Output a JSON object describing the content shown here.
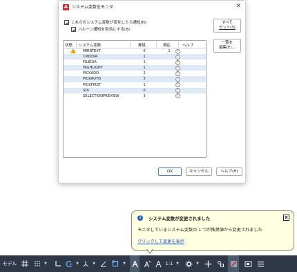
{
  "dialog": {
    "title": "システム変数をモニタ",
    "checkbox_notify": "これらのシステム変数が変化したら通知(N)",
    "checkbox_balloon": "バルーン通知を有効にする(B)",
    "columns": [
      "状態",
      "システム変数",
      "推奨",
      "現在",
      "ヘルプ"
    ],
    "rows": [
      {
        "warn": true,
        "name": "MIRRTEXT",
        "recommended": "0",
        "current": "1"
      },
      {
        "warn": false,
        "name": "CMDDIA",
        "recommended": "1",
        "current": ""
      },
      {
        "warn": false,
        "name": "FILEDIA",
        "recommended": "1",
        "current": ""
      },
      {
        "warn": false,
        "name": "HIGHLIGHT",
        "recommended": "1",
        "current": ""
      },
      {
        "warn": false,
        "name": "PICKADD",
        "recommended": "2",
        "current": ""
      },
      {
        "warn": false,
        "name": "PICKAUTO",
        "recommended": "5",
        "current": ""
      },
      {
        "warn": false,
        "name": "PICKFIRST",
        "recommended": "1",
        "current": ""
      },
      {
        "warn": false,
        "name": "SDI",
        "recommended": "0",
        "current": ""
      },
      {
        "warn": false,
        "name": "SELECTIONPREVIEW",
        "recommended": "3",
        "current": ""
      }
    ],
    "help_glyph": "?",
    "reset_all_label_1": "すべて",
    "reset_all_label_2": "セット(S)",
    "edit_list_label_1": "一覧を",
    "edit_list_label_2": "編集(E)...",
    "ok_label": "OK",
    "cancel_label": "キャンセル",
    "help_label": "ヘルプ(H)"
  },
  "balloon": {
    "title": "システム変数が変更されました",
    "message": "モニタしているシステム変数の 1 つが推奨値から変更されました",
    "link": "クリックして変更を表示",
    "info_glyph": "i",
    "close_glyph": "x"
  },
  "statusbar": {
    "model_label": "モデル",
    "scale_label": "1:1",
    "caret": "▼"
  },
  "colors": {
    "alt_row": "#dde9f7",
    "warning": "#f0a400",
    "statusbar_bg": "#2f3846",
    "balloon_bg": "#ffffe1",
    "link": "#1a4fd0"
  }
}
